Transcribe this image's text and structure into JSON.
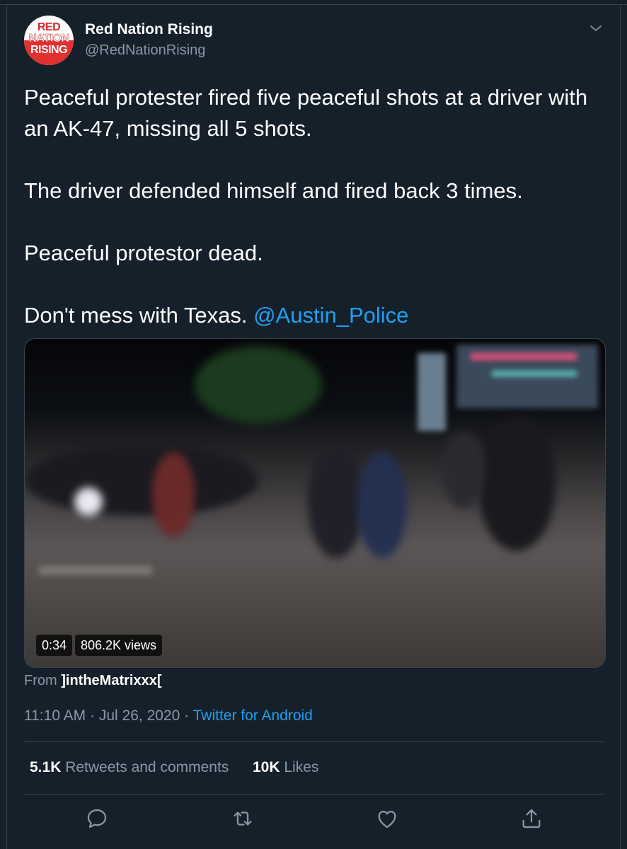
{
  "author": {
    "name": "Red Nation Rising",
    "handle": "@RedNationRising",
    "avatar_text": [
      "RED",
      "NATION",
      "RISING"
    ]
  },
  "tweet": {
    "lines": [
      "Peaceful protester fired five peaceful shots at a driver with an AK-47, missing all 5 shots.",
      "",
      "The driver defended himself and fired back 3 times.",
      "",
      "Peaceful protestor dead.",
      "",
      "Don't mess with Texas. "
    ],
    "mention": "@Austin_Police"
  },
  "video": {
    "duration": "0:34",
    "views": "806.2K views"
  },
  "attribution": {
    "prefix": "From",
    "source_user": "]intheMatrixxx["
  },
  "meta": {
    "time": "11:10 AM",
    "separator1": "·",
    "date": "Jul 26, 2020",
    "separator2": "·",
    "client": "Twitter for Android"
  },
  "stats": {
    "retweets_count": "5.1K",
    "retweets_label": "Retweets and comments",
    "likes_count": "10K",
    "likes_label": "Likes"
  },
  "icons": {
    "menu": "chevron-down-icon",
    "reply": "reply-icon",
    "retweet": "retweet-icon",
    "like": "heart-icon",
    "share": "share-icon"
  },
  "colors": {
    "background": "#15202b",
    "accent": "#1da1f2",
    "secondary_text": "#8899a6",
    "border": "#38444d"
  }
}
